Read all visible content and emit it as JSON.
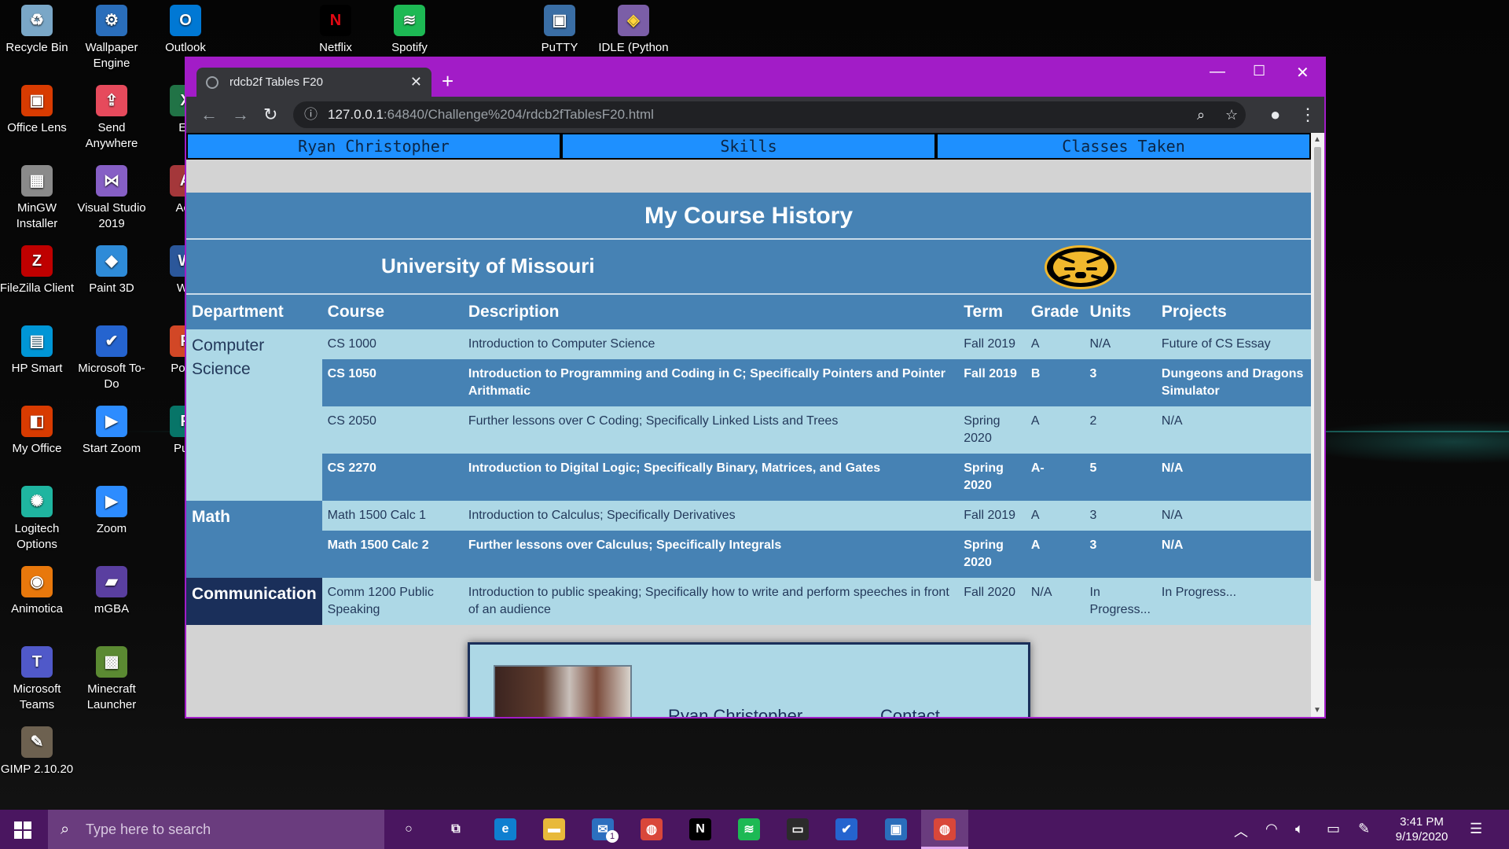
{
  "desktop": {
    "icons_col1": [
      {
        "label": "Recycle Bin",
        "icon": "recycle-bin-icon",
        "color": "#7aa7c7",
        "glyph": "♻"
      },
      {
        "label": "Office Lens",
        "icon": "office-lens-icon",
        "color": "#d83b01",
        "glyph": "▣"
      },
      {
        "label": "MinGW Installer",
        "icon": "mingw-icon",
        "color": "#8a8a8a",
        "glyph": "▦"
      },
      {
        "label": "FileZilla Client",
        "icon": "filezilla-icon",
        "color": "#bf0000",
        "glyph": "Z"
      },
      {
        "label": "HP Smart",
        "icon": "hp-smart-icon",
        "color": "#0096d6",
        "glyph": "▤"
      },
      {
        "label": "My Office",
        "icon": "office-icon",
        "color": "#d83b01",
        "glyph": "◧"
      },
      {
        "label": "Logitech Options",
        "icon": "logitech-icon",
        "color": "#1fb5a0",
        "glyph": "✺"
      },
      {
        "label": "Animotica",
        "icon": "animotica-icon",
        "color": "#e8780c",
        "glyph": "◉"
      },
      {
        "label": "Microsoft Teams",
        "icon": "teams-icon",
        "color": "#5059c9",
        "glyph": "T"
      },
      {
        "label": "GIMP 2.10.20",
        "icon": "gimp-icon",
        "color": "#6d6150",
        "glyph": "✎"
      }
    ],
    "icons_col2": [
      {
        "label": "Wallpaper Engine",
        "icon": "wallpaper-engine-icon",
        "color": "#2a6ebb",
        "glyph": "⚙"
      },
      {
        "label": "Send Anywhere",
        "icon": "send-anywhere-icon",
        "color": "#e64a5c",
        "glyph": "⇪"
      },
      {
        "label": "Visual Studio 2019",
        "icon": "visual-studio-icon",
        "color": "#865fc5",
        "glyph": "⋈"
      },
      {
        "label": "Paint 3D",
        "icon": "paint-3d-icon",
        "color": "#2e8bd8",
        "glyph": "◆"
      },
      {
        "label": "Microsoft To-Do",
        "icon": "todo-icon",
        "color": "#2564cf",
        "glyph": "✔"
      },
      {
        "label": "Start Zoom",
        "icon": "zoom-icon",
        "color": "#2d8cff",
        "glyph": "▶"
      },
      {
        "label": "Zoom",
        "icon": "zoom-icon",
        "color": "#2d8cff",
        "glyph": "▶"
      },
      {
        "label": "mGBA",
        "icon": "mgba-icon",
        "color": "#5a3fa0",
        "glyph": "▰"
      },
      {
        "label": "Minecraft Launcher",
        "icon": "minecraft-icon",
        "color": "#5b8a32",
        "glyph": "▩"
      }
    ],
    "icons_col3": [
      {
        "label": "Outlook",
        "icon": "outlook-icon",
        "color": "#0078d4",
        "glyph": "O"
      },
      {
        "label": "Ex",
        "icon": "excel-icon",
        "color": "#217346",
        "glyph": "X"
      },
      {
        "label": "Acc",
        "icon": "access-icon",
        "color": "#a4373a",
        "glyph": "A"
      },
      {
        "label": "Wo",
        "icon": "word-icon",
        "color": "#2b579a",
        "glyph": "W"
      },
      {
        "label": "Powe",
        "icon": "powerpoint-icon",
        "color": "#d24726",
        "glyph": "P"
      },
      {
        "label": "Publ",
        "icon": "publisher-icon",
        "color": "#077568",
        "glyph": "P"
      }
    ],
    "icons_top": [
      {
        "label": "Netflix",
        "icon": "netflix-icon",
        "color": "#000000",
        "glyph": "N",
        "fg": "#e50914"
      },
      {
        "label": "Spotify",
        "icon": "spotify-icon",
        "color": "#1db954",
        "glyph": "≋",
        "fg": "#ffffff"
      },
      {
        "label": "PuTTY",
        "icon": "putty-icon",
        "color": "#3a6ea5",
        "glyph": "▣",
        "fg": "#ffffff"
      },
      {
        "label": "IDLE (Python",
        "icon": "python-idle-icon",
        "color": "#7b5ea7",
        "glyph": "◈",
        "fg": "#ffd43b"
      }
    ]
  },
  "browser": {
    "tab_title": "rdcb2f Tables F20",
    "url_host": "127.0.0.1",
    "url_path": ":64840/Challenge%204/rdcb2fTablesF20.html",
    "accent": "#a21cc7"
  },
  "page": {
    "nav": [
      "Ryan Christopher",
      "Skills",
      "Classes Taken"
    ],
    "title": "My Course History",
    "university": "University of Missouri",
    "headers": [
      "Department",
      "Course",
      "Description",
      "Term",
      "Grade",
      "Units",
      "Projects"
    ],
    "departments": {
      "cs": "Computer Science",
      "math": "Math",
      "comm": "Communication"
    },
    "rows": [
      {
        "course": "CS 1000",
        "desc": "Introduction to Computer Science",
        "term": "Fall 2019",
        "grade": "A",
        "units": "N/A",
        "projects": "Future of CS Essay"
      },
      {
        "course": "CS 1050",
        "desc": "Introduction to Programming and Coding in C; Specifically Pointers and Pointer Arithmatic",
        "term": "Fall 2019",
        "grade": "B",
        "units": "3",
        "projects": "Dungeons and Dragons Simulator"
      },
      {
        "course": "CS 2050",
        "desc": "Further lessons over C Coding; Specifically Linked Lists and Trees",
        "term": "Spring 2020",
        "grade": "A",
        "units": "2",
        "projects": "N/A"
      },
      {
        "course": "CS 2270",
        "desc": "Introduction to Digital Logic; Specifically Binary, Matrices, and Gates",
        "term": "Spring 2020",
        "grade": "A-",
        "units": "5",
        "projects": "N/A"
      },
      {
        "course": "Math 1500 Calc 1",
        "desc": "Introduction to Calculus; Specifically Derivatives",
        "term": "Fall 2019",
        "grade": "A",
        "units": "3",
        "projects": "N/A"
      },
      {
        "course": "Math 1500 Calc 2",
        "desc": "Further lessons over Calculus; Specifically Integrals",
        "term": "Spring 2020",
        "grade": "A",
        "units": "3",
        "projects": "N/A"
      },
      {
        "course": "Comm 1200 Public Speaking",
        "desc": "Introduction to public speaking; Specifically how to write and perform speeches in front of an audience",
        "term": "Fall 2020",
        "grade": "N/A",
        "units": "In Progress...",
        "projects": "In Progress..."
      }
    ],
    "card": {
      "name": "Ryan Christopher",
      "contact": "Contact"
    }
  },
  "taskbar": {
    "search_placeholder": "Type here to search",
    "time": "3:41 PM",
    "date": "9/19/2020",
    "mail_badge": "1",
    "apps": [
      {
        "name": "cortana-icon",
        "glyph": "○",
        "color": "transparent"
      },
      {
        "name": "task-view-icon",
        "glyph": "⧉",
        "color": "transparent"
      },
      {
        "name": "edge-icon",
        "glyph": "e",
        "color": "#0f7fd0"
      },
      {
        "name": "file-explorer-icon",
        "glyph": "▬",
        "color": "#e8b93a"
      },
      {
        "name": "mail-icon",
        "glyph": "✉",
        "color": "#2c6fbf"
      },
      {
        "name": "chrome-icon",
        "glyph": "◍",
        "color": "#d9473a"
      },
      {
        "name": "netflix-icon",
        "glyph": "N",
        "color": "#000000"
      },
      {
        "name": "spotify-icon",
        "glyph": "≋",
        "color": "#1db954"
      },
      {
        "name": "terminal-icon",
        "glyph": "▭",
        "color": "#2b2b2b"
      },
      {
        "name": "todo-icon",
        "glyph": "✔",
        "color": "#2564cf"
      },
      {
        "name": "wallpaper-engine-icon",
        "glyph": "▣",
        "color": "#2a6ebb"
      },
      {
        "name": "chrome-icon",
        "glyph": "◍",
        "color": "#d9473a"
      }
    ]
  }
}
